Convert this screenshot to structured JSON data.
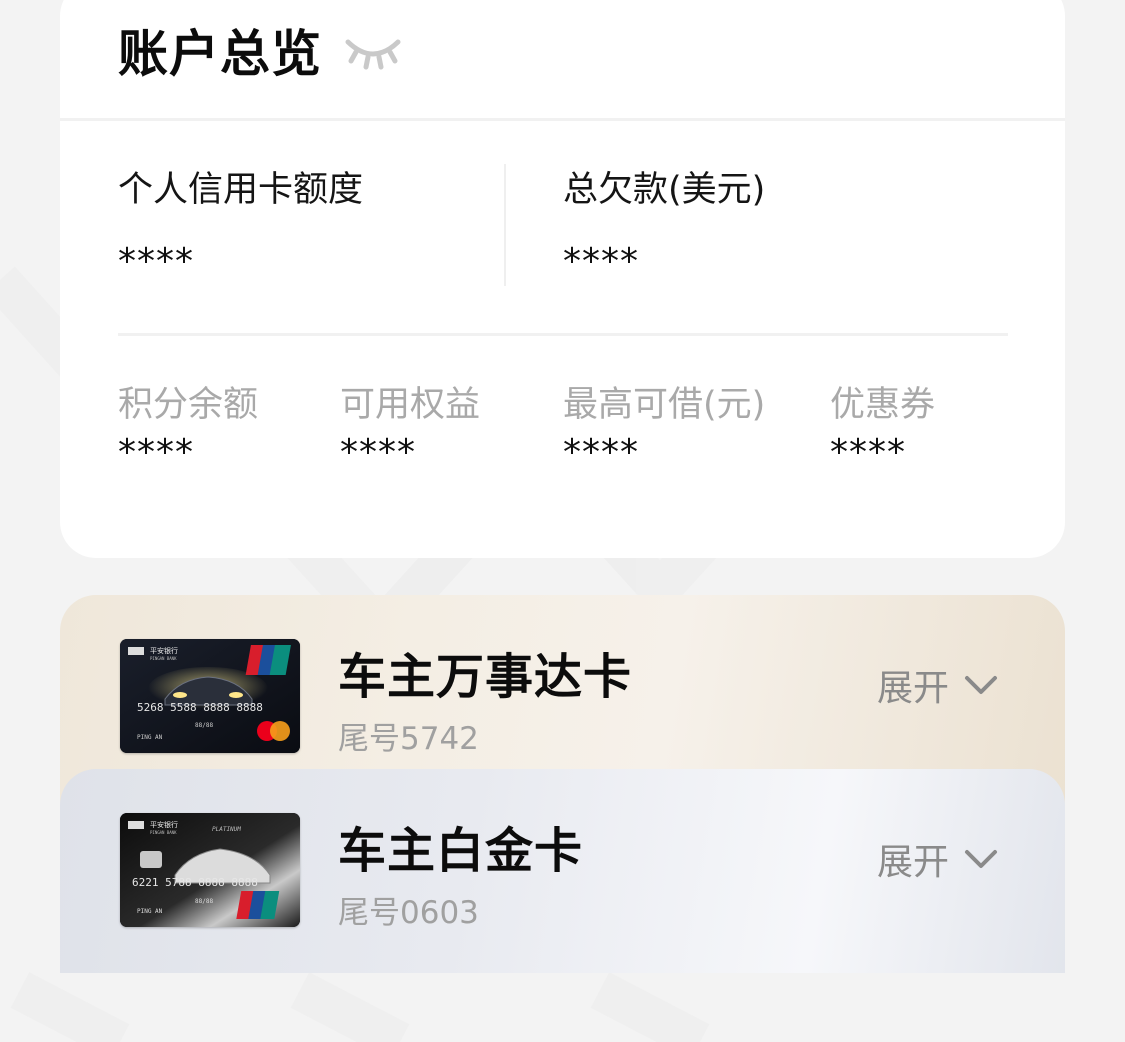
{
  "overview": {
    "title": "账户总览",
    "icons": {
      "visibility_toggle": "eye-closed-icon"
    },
    "credit_limit": {
      "label": "个人信用卡额度",
      "value": "****"
    },
    "total_debt": {
      "label": "总欠款(美元)",
      "value": "****"
    },
    "stats": [
      {
        "label": "积分余额",
        "value": "****"
      },
      {
        "label": "可用权益",
        "value": "****"
      },
      {
        "label": "最高可借(元)",
        "value": "****"
      },
      {
        "label": "优惠券",
        "value": "****"
      }
    ]
  },
  "cards": [
    {
      "name": "车主万事达卡",
      "tail": "尾号5742",
      "expand_label": "展开",
      "icon": "chevron-down-icon",
      "thumbnail": {
        "bank": "平安银行",
        "bank_en": "PINGAN BANK",
        "number": "5268 5588 8888 8888",
        "valid": "88/88",
        "holder": "PING AN",
        "network_badges": [
          "UnionPay 银联",
          "MasterCard"
        ]
      }
    },
    {
      "name": "车主白金卡",
      "tail": "尾号0603",
      "expand_label": "展开",
      "icon": "chevron-down-icon",
      "thumbnail": {
        "bank": "平安银行",
        "bank_en": "PINGAN BANK",
        "tier": "PLATINUM",
        "number": "6221 5788 8888 8888",
        "valid": "88/88",
        "holder": "PING AN",
        "network_badges": [
          "UnionPay 银联"
        ]
      }
    }
  ],
  "colors": {
    "background": "#f3f3f3",
    "card_bg": "#ffffff",
    "muted_label": "#a9a9a9",
    "gold_card": "#efe7da",
    "platinum_card": "#e8eaf0",
    "unionpay_red": "#d81e2c",
    "unionpay_blue": "#1b4f9c",
    "unionpay_green": "#0b8e7e"
  }
}
